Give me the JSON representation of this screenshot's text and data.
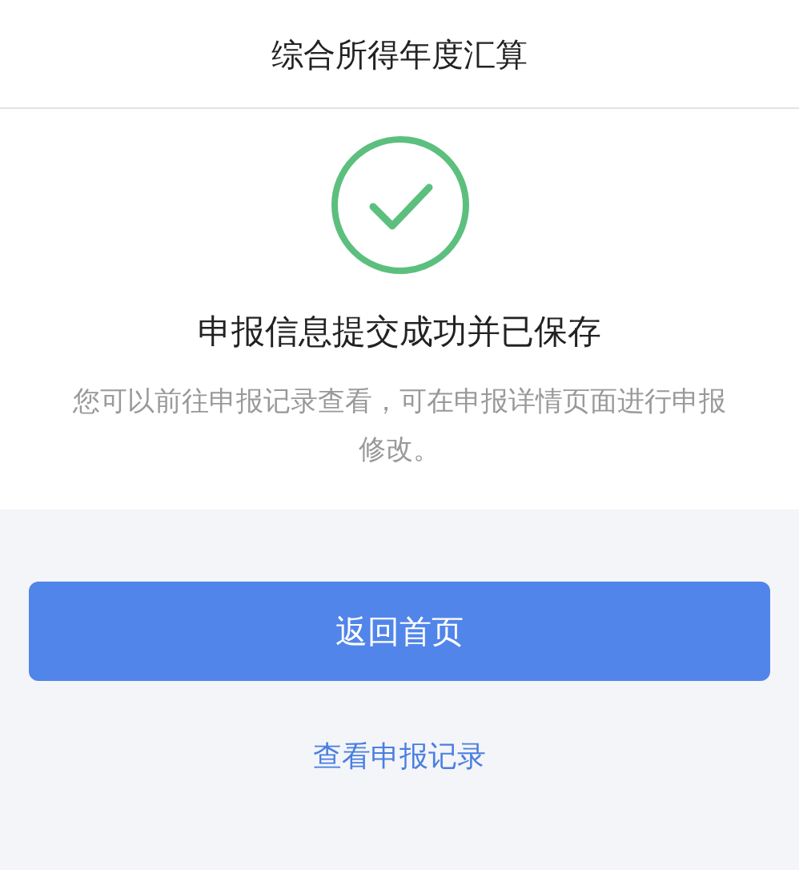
{
  "header": {
    "title": "综合所得年度汇算"
  },
  "result": {
    "title": "申报信息提交成功并已保存",
    "description": "您可以前往申报记录查看，可在申报详情页面进行申报修改。"
  },
  "primary_button": {
    "label": "返回首页"
  },
  "link": {
    "label": "查看申报记录"
  }
}
